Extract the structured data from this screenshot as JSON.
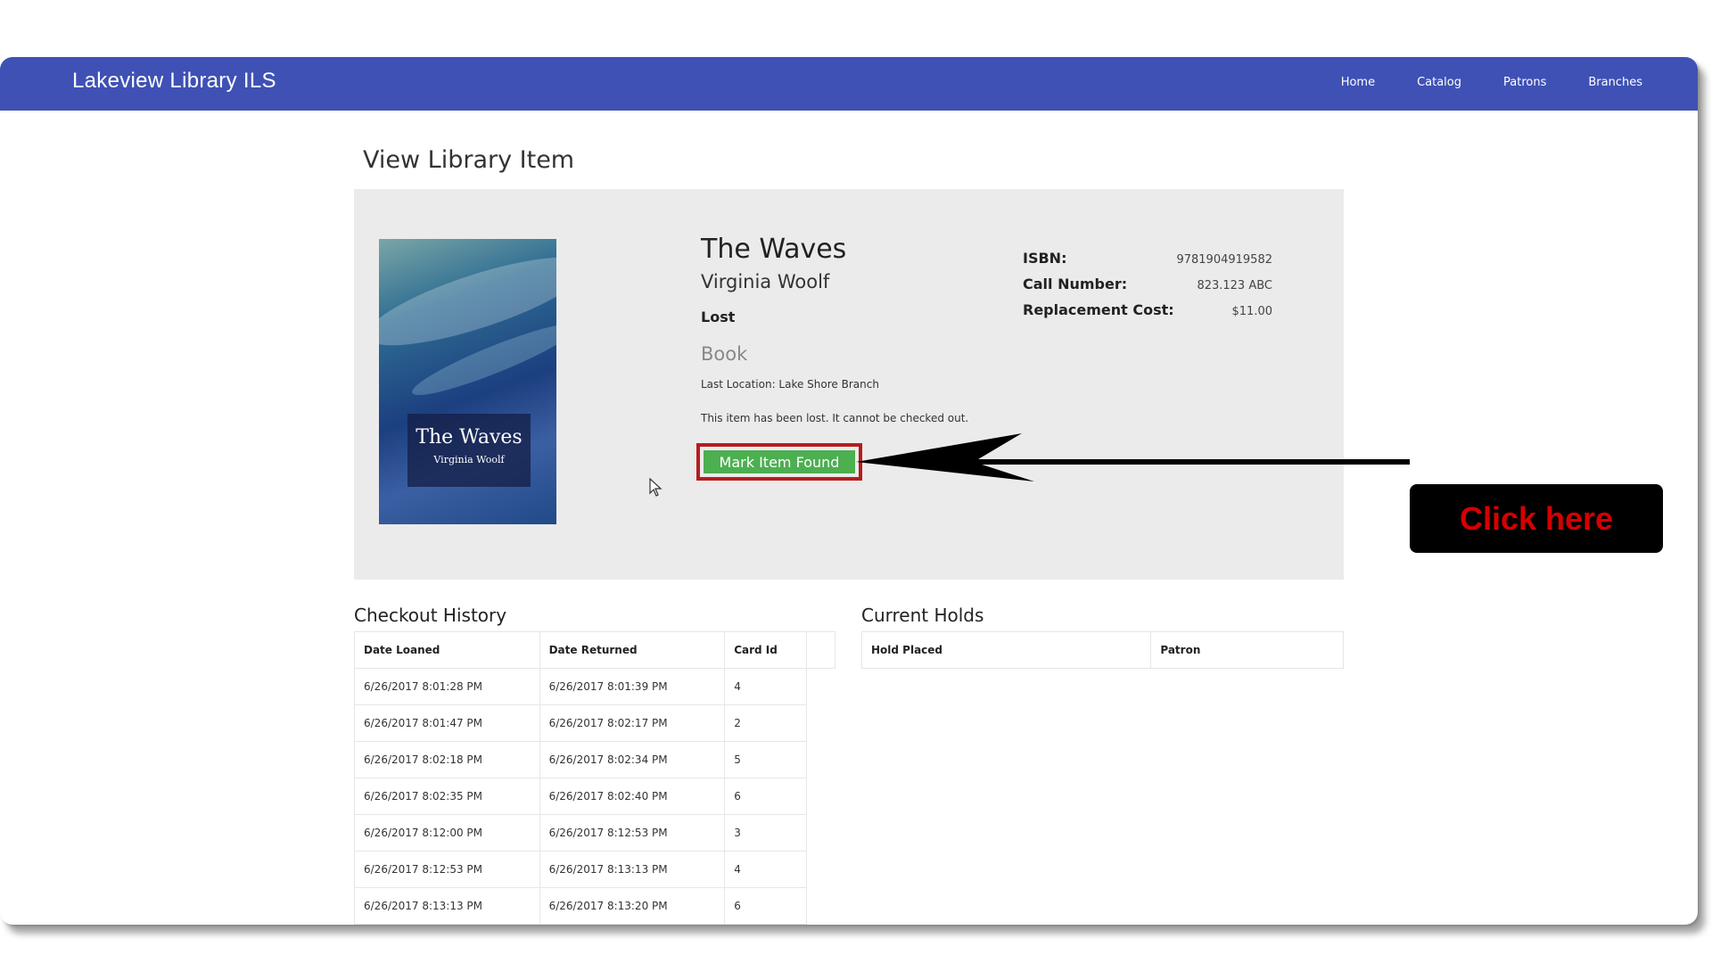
{
  "navbar": {
    "brand": "Lakeview Library ILS",
    "links": [
      "Home",
      "Catalog",
      "Patrons",
      "Branches"
    ]
  },
  "page": {
    "title": "View Library Item"
  },
  "item": {
    "cover": {
      "title": "The Waves",
      "author": "Virginia Woolf"
    },
    "title": "The Waves",
    "author": "Virginia Woolf",
    "status": "Lost",
    "type": "Book",
    "location": "Last Location: Lake Shore Branch",
    "message": "This item has been lost. It cannot be checked out.",
    "found_button": "Mark Item Found",
    "details": [
      {
        "label": "ISBN:",
        "value": "9781904919582"
      },
      {
        "label": "Call Number:",
        "value": "823.123 ABC"
      },
      {
        "label": "Replacement Cost:",
        "value": "$11.00"
      }
    ]
  },
  "checkout_history": {
    "title": "Checkout History",
    "columns": [
      "Date Loaned",
      "Date Returned",
      "Card Id"
    ],
    "rows": [
      [
        "6/26/2017 8:01:28 PM",
        "6/26/2017 8:01:39 PM",
        "4"
      ],
      [
        "6/26/2017 8:01:47 PM",
        "6/26/2017 8:02:17 PM",
        "2"
      ],
      [
        "6/26/2017 8:02:18 PM",
        "6/26/2017 8:02:34 PM",
        "5"
      ],
      [
        "6/26/2017 8:02:35 PM",
        "6/26/2017 8:02:40 PM",
        "6"
      ],
      [
        "6/26/2017 8:12:00 PM",
        "6/26/2017 8:12:53 PM",
        "3"
      ],
      [
        "6/26/2017 8:12:53 PM",
        "6/26/2017 8:13:13 PM",
        "4"
      ],
      [
        "6/26/2017 8:13:13 PM",
        "6/26/2017 8:13:20 PM",
        "6"
      ]
    ]
  },
  "current_holds": {
    "title": "Current Holds",
    "columns": [
      "Hold Placed",
      "Patron"
    ]
  },
  "annotation": {
    "callout_text": "Click here"
  },
  "colors": {
    "navbar": "#3f51b5",
    "panel": "#ebebeb",
    "button": "#4caf50",
    "highlight": "#b71c1c",
    "callout_text": "#d50000"
  }
}
